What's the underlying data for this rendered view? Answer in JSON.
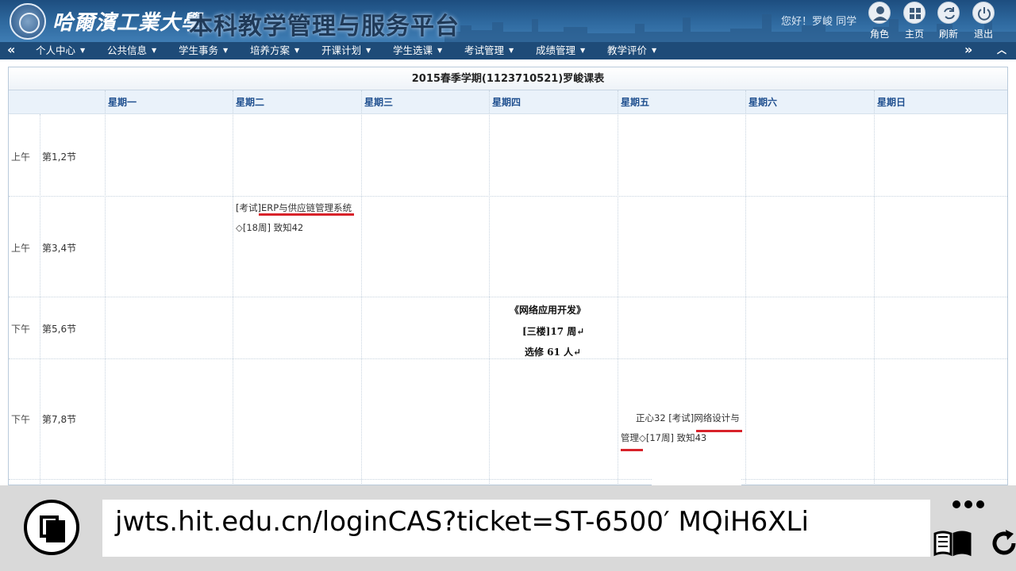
{
  "header": {
    "school_name": "哈爾濱工業大學",
    "platform_title": "本科教学管理与服务平台",
    "greeting": "您好！罗峻 同学",
    "buttons": [
      {
        "label": "角色",
        "icon": "user-icon"
      },
      {
        "label": "主页",
        "icon": "grid-icon"
      },
      {
        "label": "刷新",
        "icon": "refresh-icon"
      },
      {
        "label": "退出",
        "icon": "power-icon"
      }
    ]
  },
  "nav": {
    "left_arrow": "«",
    "right_arrow": "»",
    "items": [
      "个人中心",
      "公共信息",
      "学生事务",
      "培养方案",
      "开课计划",
      "学生选课",
      "考试管理",
      "成绩管理",
      "教学评价"
    ]
  },
  "timetable": {
    "title": "2015春季学期(1123710521)罗峻课表",
    "days": [
      "星期一",
      "星期二",
      "星期三",
      "星期四",
      "星期五",
      "星期六",
      "星期日"
    ],
    "periods": [
      {
        "half": "上午",
        "slot": "第1,2节"
      },
      {
        "half": "上午",
        "slot": "第3,4节"
      },
      {
        "half": "下午",
        "slot": "第5,6节"
      },
      {
        "half": "下午",
        "slot": "第7,8节"
      }
    ],
    "course_tue": {
      "line1": "[考试]ERP与供应链管理系统",
      "line2": "◇[18周] 致知42"
    },
    "course_fri": {
      "line1": "正心32 [考试]网络设计与",
      "line2": "管理◇[17周] 致知43"
    },
    "note_thu": {
      "line1": "《网络应用开发》",
      "line2": "[三楼]17 周↵",
      "line3": "选修 61 人↵"
    }
  },
  "browser": {
    "url": "jwts.hit.edu.cn/loginCAS?ticket=ST-6500′ MQiH6XLi"
  },
  "colors": {
    "header_top": "#1d4d7f",
    "nav_bg": "#1e4b78",
    "day_header_text": "#1f4f8f",
    "underline_red": "#d8222a"
  }
}
